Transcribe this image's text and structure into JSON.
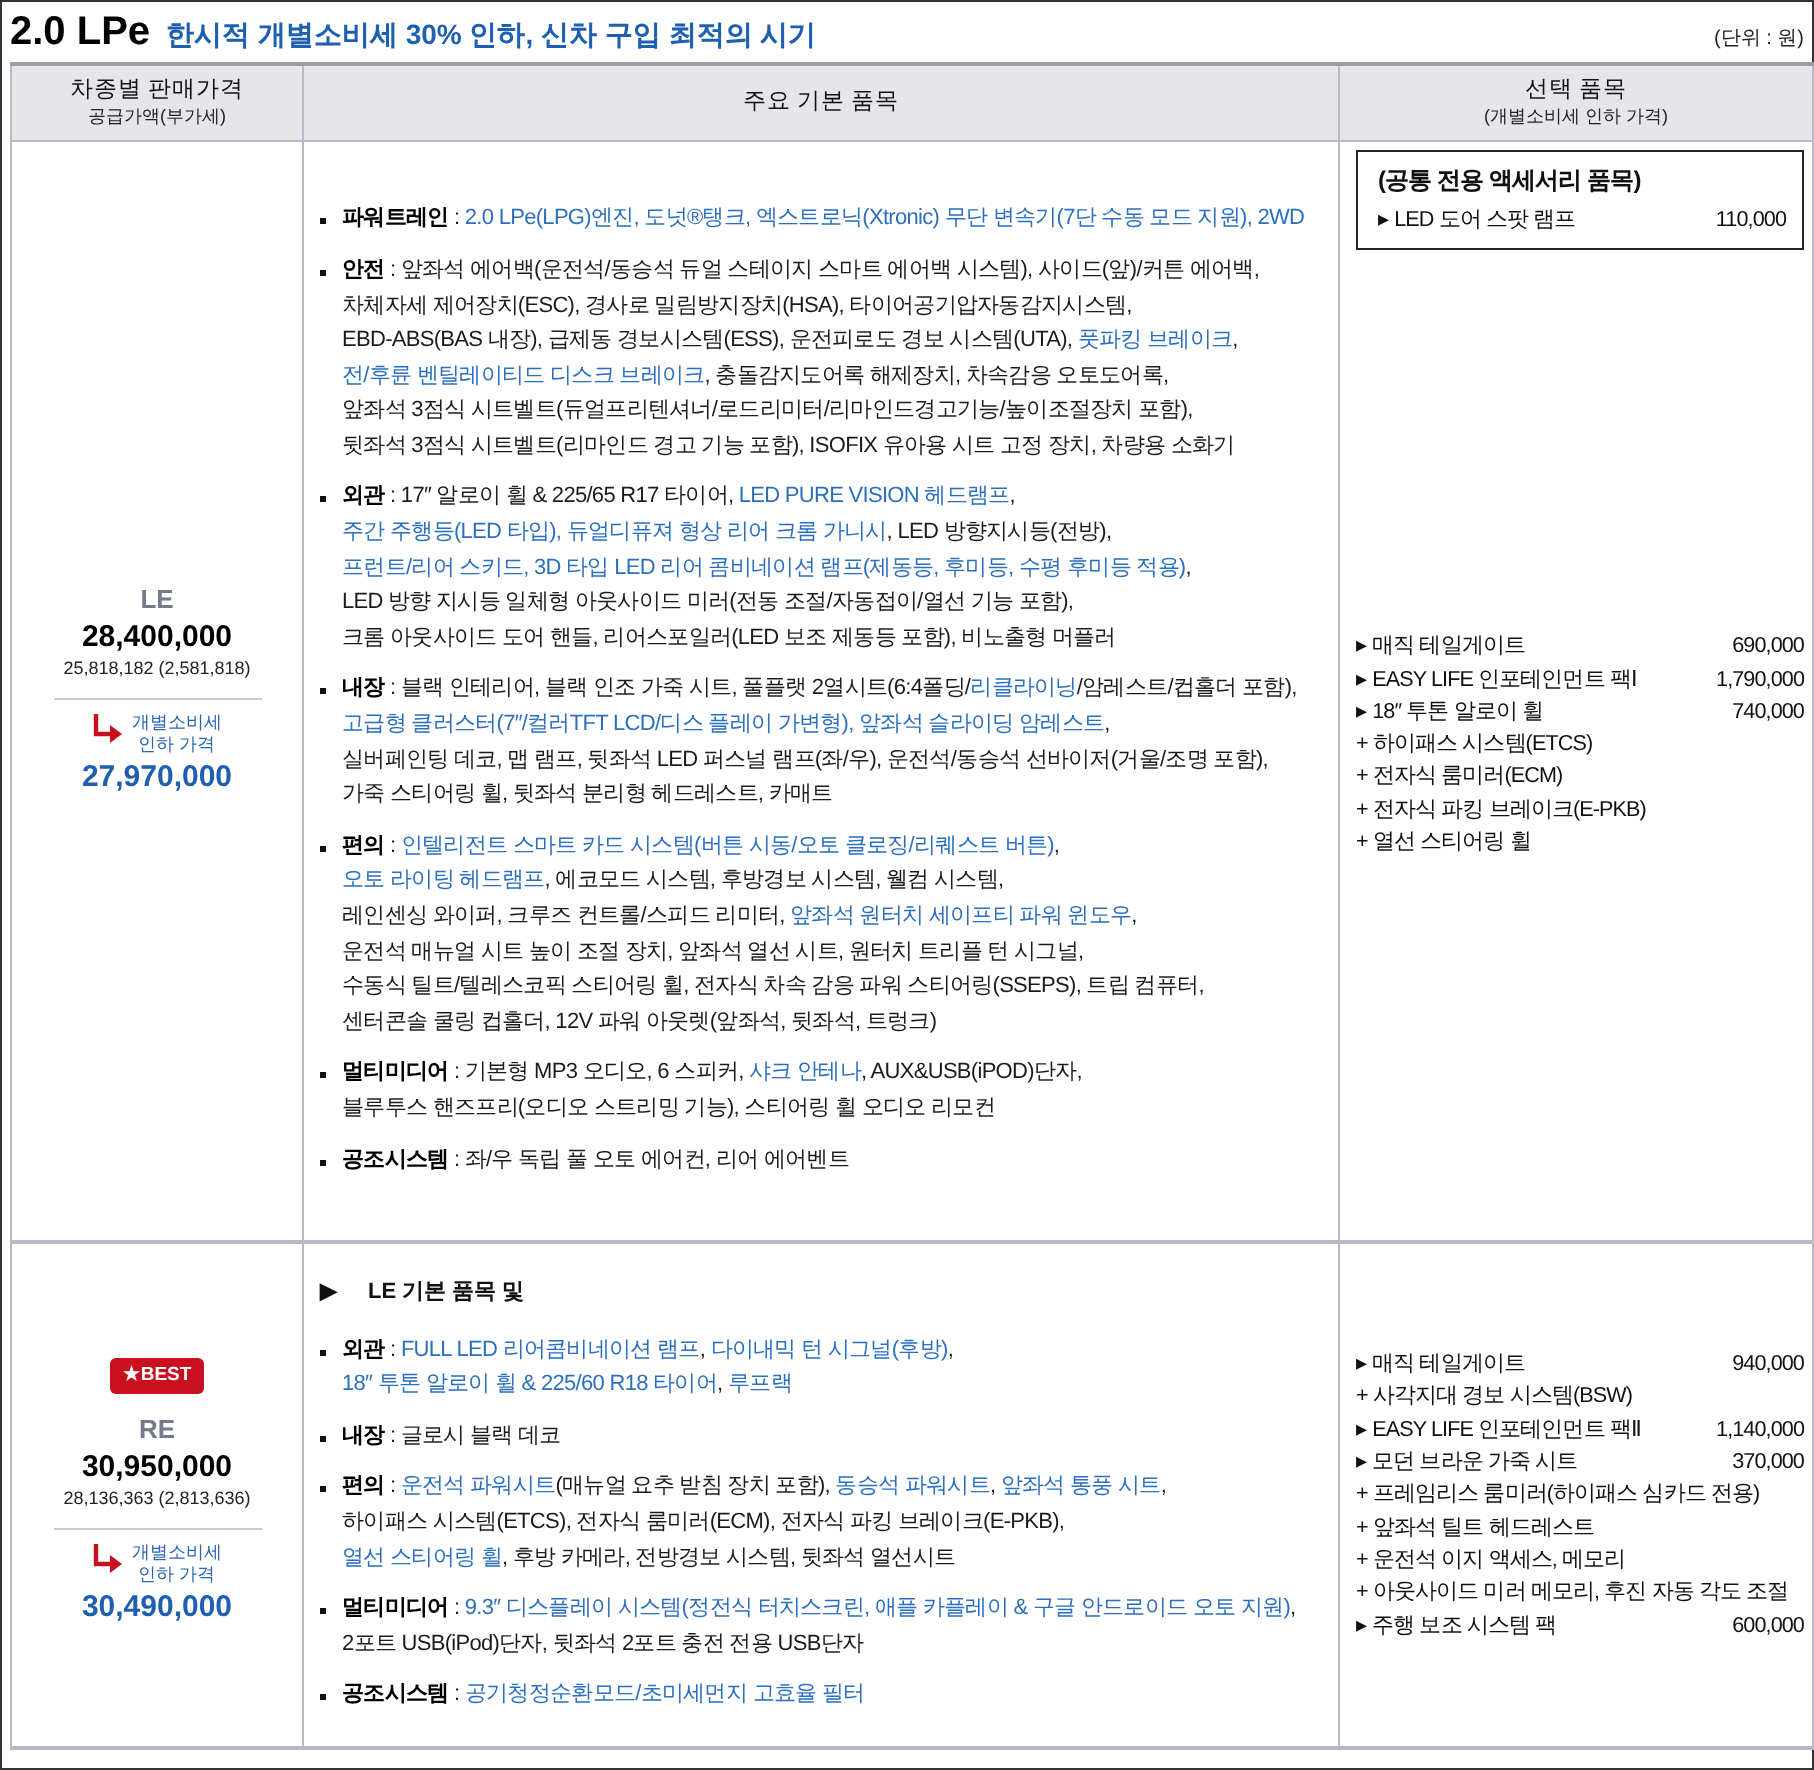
{
  "heading": {
    "title": "2.0 LPe",
    "subtitle": "한시적 개별소비세 30% 인하, 신차 구입 최적의 시기"
  },
  "unit": "(단위 : 원)",
  "columns": [
    {
      "label": "차종별 판매가격",
      "sublabel": "공급가액(부가세)"
    },
    {
      "label": "주요 기본 품목"
    },
    {
      "label": "선택 품목",
      "sublabel": "(개별소비세 인하 가격)"
    }
  ],
  "trims": [
    {
      "name": "LE",
      "price": "28,400,000",
      "supply_price": "25,818,182 (2,581,818)",
      "discount_label": [
        "개별소비세",
        "인하 가격"
      ],
      "discounted_price": "27,970,000",
      "features": {
        "groups": [
          {
            "label": "파워트레인",
            "lines": [
              [
                {
                  "text": " : ",
                  "highlight": false
                },
                {
                  "text": "2.0 LPe(LPG)엔진, 도넛®탱크, 엑스트로닉(Xtronic) 무단 변속기(7단 수동 모드 지원), 2WD",
                  "highlight": true
                }
              ]
            ]
          },
          {
            "label": "안전",
            "lines": [
              [
                {
                  "text": " : 앞좌석 에어백(운전석/동승석 듀얼 스테이지 스마트 에어백 시스템), 사이드(앞)/커튼 에어백,",
                  "highlight": false
                }
              ],
              [
                {
                  "text": "차체자세 제어장치(ESC), 경사로 밀림방지장치(HSA), 타이어공기압자동감지시스템,",
                  "highlight": false
                }
              ],
              [
                {
                  "text": "EBD-ABS(BAS 내장), 급제동 경보시스템(ESS), 운전피로도 경보 시스템(UTA), ",
                  "highlight": false
                },
                {
                  "text": "풋파킹 브레이크",
                  "highlight": true
                },
                {
                  "text": ",",
                  "highlight": false
                }
              ],
              [
                {
                  "text": "전/후륜 벤틸레이티드 디스크 브레이크",
                  "highlight": true
                },
                {
                  "text": ", 충돌감지도어록 해제장치, 차속감응 오토도어록,",
                  "highlight": false
                }
              ],
              [
                {
                  "text": "앞좌석 3점식 시트벨트(듀얼프리텐셔너/로드리미터/리마인드경고기능/높이조절장치 포함),",
                  "highlight": false
                }
              ],
              [
                {
                  "text": "뒷좌석 3점식 시트벨트(리마인드 경고 기능 포함), ISOFIX 유아용 시트 고정 장치, 차량용 소화기",
                  "highlight": false
                }
              ]
            ]
          },
          {
            "label": "외관",
            "lines": [
              [
                {
                  "text": " : 17″ 알로이 휠 & 225/65 R17 타이어, ",
                  "highlight": false
                },
                {
                  "text": "LED PURE VISION 헤드램프",
                  "highlight": true
                },
                {
                  "text": ",",
                  "highlight": false
                }
              ],
              [
                {
                  "text": "주간 주행등(LED 타입), ",
                  "highlight": true
                },
                {
                  "text": "듀얼디퓨져 형상 리어 크롬 가니시",
                  "highlight": true
                },
                {
                  "text": ", LED 방향지시등(전방),",
                  "highlight": false
                }
              ],
              [
                {
                  "text": "프런트/리어 스키드, ",
                  "highlight": true
                },
                {
                  "text": "3D 타입 LED 리어 콤비네이션 램프(제동등, 후미등, 수평 후미등 적용)",
                  "highlight": true
                },
                {
                  "text": ",",
                  "highlight": false
                }
              ],
              [
                {
                  "text": "LED 방향 지시등 일체형 아웃사이드 미러(전동 조절/자동접이/열선 기능 포함),",
                  "highlight": false
                }
              ],
              [
                {
                  "text": "크롬 아웃사이드 도어 핸들, 리어스포일러(LED 보조 제동등 포함), 비노출형 머플러",
                  "highlight": false
                }
              ]
            ]
          },
          {
            "label": "내장",
            "lines": [
              [
                {
                  "text": " : 블랙 인테리어, 블랙 인조 가죽 시트, 풀플랫 2열시트(6:4폴딩/",
                  "highlight": false
                },
                {
                  "text": "리클라이닝",
                  "highlight": true
                },
                {
                  "text": "/암레스트/컵홀더 포함),",
                  "highlight": false
                }
              ],
              [
                {
                  "text": "고급형 클러스터(7″/컬러TFT LCD/디스 플레이 가변형), ",
                  "highlight": true
                },
                {
                  "text": "앞좌석 슬라이딩 암레스트",
                  "highlight": true
                },
                {
                  "text": ",",
                  "highlight": false
                }
              ],
              [
                {
                  "text": "실버페인팅 데코, 맵 램프, 뒷좌석 LED 퍼스널 램프(좌/우), 운전석/동승석 선바이저(거울/조명 포함),",
                  "highlight": false
                }
              ],
              [
                {
                  "text": "가죽 스티어링 휠, 뒷좌석 분리형 헤드레스트, 카매트",
                  "highlight": false
                }
              ]
            ]
          },
          {
            "label": "편의",
            "lines": [
              [
                {
                  "text": " : ",
                  "highlight": false
                },
                {
                  "text": "인텔리전트 스마트 카드 시스템(버튼 시동/오토 클로징/리퀘스트 버튼)",
                  "highlight": true
                },
                {
                  "text": ",",
                  "highlight": false
                }
              ],
              [
                {
                  "text": "오토 라이팅 헤드램프",
                  "highlight": true
                },
                {
                  "text": ", 에코모드 시스템, 후방경보 시스템, 웰컴 시스템,",
                  "highlight": false
                }
              ],
              [
                {
                  "text": "레인센싱 와이퍼, 크루즈 컨트롤/스피드 리미터, ",
                  "highlight": false
                },
                {
                  "text": "앞좌석 원터치 세이프티 파워 윈도우",
                  "highlight": true
                },
                {
                  "text": ",",
                  "highlight": false
                }
              ],
              [
                {
                  "text": "운전석 매뉴얼 시트 높이 조절 장치, 앞좌석 열선 시트, 원터치 트리플 턴 시그널,",
                  "highlight": false
                }
              ],
              [
                {
                  "text": "수동식 틸트/텔레스코픽 스티어링 휠, 전자식 차속 감응 파워 스티어링(SSEPS), 트립 컴퓨터,",
                  "highlight": false
                }
              ],
              [
                {
                  "text": "센터콘솔 쿨링 컵홀더, 12V 파워 아웃렛(앞좌석, 뒷좌석, 트렁크)",
                  "highlight": false
                }
              ]
            ]
          },
          {
            "label": "멀티미디어",
            "lines": [
              [
                {
                  "text": " : 기본형 MP3 오디오, 6 스피커, ",
                  "highlight": false
                },
                {
                  "text": "샤크 안테나",
                  "highlight": true
                },
                {
                  "text": ", AUX&USB(iPOD)단자,",
                  "highlight": false
                }
              ],
              [
                {
                  "text": "블루투스 핸즈프리(오디오 스트리밍 기능), 스티어링 휠 오디오 리모컨",
                  "highlight": false
                }
              ]
            ]
          },
          {
            "label": "공조시스템",
            "lines": [
              [
                {
                  "text": " : 좌/우 독립 풀 오토 에어컨, 리어 에어벤트",
                  "highlight": false
                }
              ]
            ]
          }
        ]
      },
      "options": {
        "common_box": {
          "title": "(공통 전용 액세서리 품목)",
          "items": [
            {
              "name": "▸ LED 도어 스팟 램프",
              "price": "110,000"
            }
          ]
        },
        "items": [
          {
            "name": "▸ 매직 테일게이트",
            "price": "690,000"
          },
          {
            "name": "▸ EASY LIFE 인포테인먼트 팩Ⅰ",
            "price": "1,790,000"
          },
          {
            "name": "▸ 18″ 투톤 알로이 휠",
            "price": "740,000"
          },
          {
            "name": "+ 하이패스 시스템(ETCS)"
          },
          {
            "name": "+ 전자식 룸미러(ECM)"
          },
          {
            "name": "+ 전자식 파킹 브레이크(E-PKB)"
          },
          {
            "name": "+ 열선 스티어링 휠"
          }
        ]
      }
    },
    {
      "name": "RE",
      "badge": "★BEST",
      "price": "30,950,000",
      "supply_price": "28,136,363 (2,813,636)",
      "discount_label": [
        "개별소비세",
        "인하 가격"
      ],
      "discounted_price": "30,490,000",
      "features": {
        "intro": {
          "marker": "▶",
          "text": "LE 기본 품목 및"
        },
        "groups": [
          {
            "label": "외관",
            "lines": [
              [
                {
                  "text": " : ",
                  "highlight": false
                },
                {
                  "text": "FULL LED 리어콤비네이션 램프",
                  "highlight": true
                },
                {
                  "text": ", ",
                  "highlight": false
                },
                {
                  "text": "다이내믹 턴 시그널(후방)",
                  "highlight": true
                },
                {
                  "text": ",",
                  "highlight": false
                }
              ],
              [
                {
                  "text": "18″ 투톤 알로이 휠 & 225/60 R18 타이어",
                  "highlight": true
                },
                {
                  "text": ", ",
                  "highlight": false
                },
                {
                  "text": "루프랙",
                  "highlight": true
                }
              ]
            ]
          },
          {
            "label": "내장",
            "lines": [
              [
                {
                  "text": " : 글로시 블랙 데코",
                  "highlight": false
                }
              ]
            ]
          },
          {
            "label": "편의",
            "lines": [
              [
                {
                  "text": " : ",
                  "highlight": false
                },
                {
                  "text": "운전석 파워시트",
                  "highlight": true
                },
                {
                  "text": "(매뉴얼 요추 받침 장치 포함), ",
                  "highlight": false
                },
                {
                  "text": "동승석 파워시트",
                  "highlight": true
                },
                {
                  "text": ", ",
                  "highlight": false
                },
                {
                  "text": "앞좌석 통풍 시트",
                  "highlight": true
                },
                {
                  "text": ",",
                  "highlight": false
                }
              ],
              [
                {
                  "text": "하이패스 시스템(ETCS), 전자식 룸미러(ECM), 전자식 파킹 브레이크(E-PKB),",
                  "highlight": false
                }
              ],
              [
                {
                  "text": "열선 스티어링 휠",
                  "highlight": true
                },
                {
                  "text": ", 후방 카메라, 전방경보 시스템, 뒷좌석 열선시트",
                  "highlight": false
                }
              ]
            ]
          },
          {
            "label": "멀티미디어",
            "lines": [
              [
                {
                  "text": " : ",
                  "highlight": false
                },
                {
                  "text": "9.3″ 디스플레이 시스템(정전식 터치스크린, 애플 카플레이 & 구글 안드로이드 오토 지원)",
                  "highlight": true
                },
                {
                  "text": ",",
                  "highlight": false
                }
              ],
              [
                {
                  "text": "2포트 USB(iPod)단자, 뒷좌석 2포트 충전 전용 USB단자",
                  "highlight": false
                }
              ]
            ]
          },
          {
            "label": "공조시스템",
            "lines": [
              [
                {
                  "text": " : ",
                  "highlight": false
                },
                {
                  "text": "공기청정순환모드/초미세먼지 고효율 필터",
                  "highlight": true
                }
              ]
            ]
          }
        ]
      },
      "options": {
        "items": [
          {
            "name": "▸ 매직 테일게이트",
            "price": "940,000"
          },
          {
            "name": "+ 사각지대 경보 시스템(BSW)"
          },
          {
            "name": "▸ EASY LIFE 인포테인먼트 팩Ⅱ",
            "price": "1,140,000"
          },
          {
            "name": "▸ 모던 브라운 가죽 시트",
            "price": "370,000"
          },
          {
            "name": "+ 프레임리스 룸미러(하이패스 심카드 전용)"
          },
          {
            "name": "+ 앞좌석 틸트 헤드레스트"
          },
          {
            "name": "+ 운전석 이지 액세스, 메모리"
          },
          {
            "name": "+ 아웃사이드 미러 메모리, 후진 자동 각도 조절"
          },
          {
            "name": "▸ 주행 보조 시스템 팩",
            "price": "600,000"
          }
        ]
      }
    }
  ]
}
